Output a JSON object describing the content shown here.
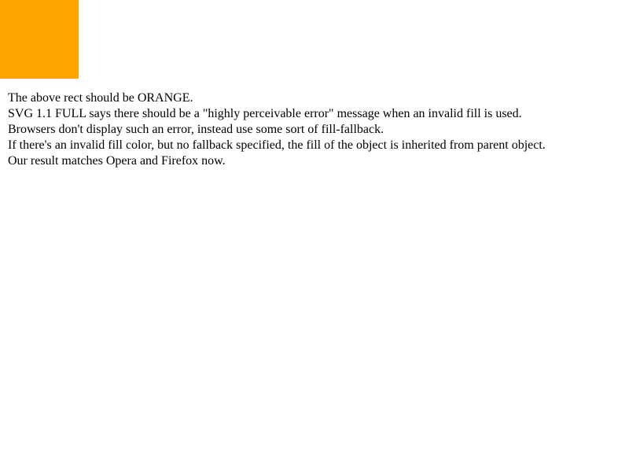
{
  "rect": {
    "fill": "#FFA500"
  },
  "notes": [
    "The above rect should be ORANGE.",
    "SVG 1.1 FULL says there should be a \"highly perceivable error\" message when an invalid fill is used.",
    "Browsers don't display such an error, instead use some sort of fill-fallback.",
    "If there's an invalid fill color, but no fallback specified, the fill of the object is inherited from parent object.",
    "Our result matches Opera and Firefox now."
  ]
}
